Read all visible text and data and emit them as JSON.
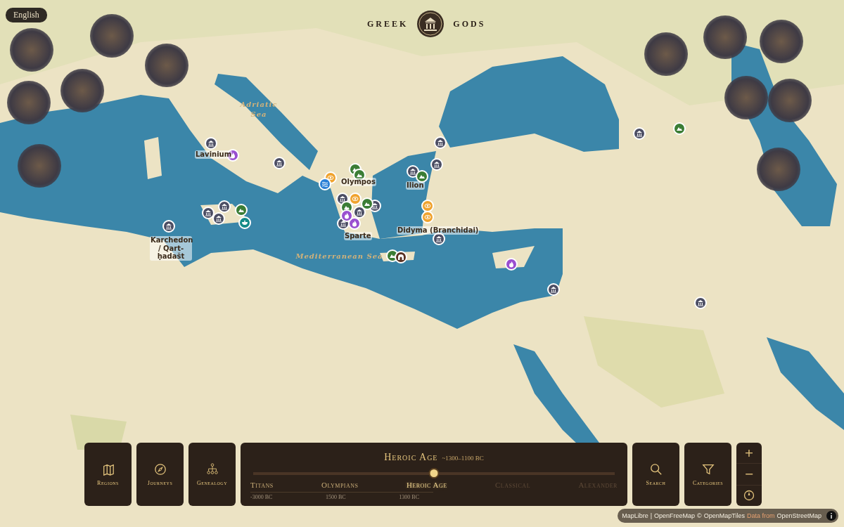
{
  "language": "English",
  "logo": {
    "left": "GREEK",
    "right": "GODS"
  },
  "sea_labels": [
    "Adriatic Sea",
    "Mediterranean Sea"
  ],
  "place_labels": [
    "Lavinium",
    "Olympos",
    "Ilion",
    "Sparte",
    "Didyma (Branchidai)",
    "Karchedon / Qart-ḥadašt"
  ],
  "markers": [
    {
      "kind": "temple",
      "color": "#4b4d63"
    },
    {
      "kind": "temple",
      "color": "#4b4d63"
    },
    {
      "kind": "temple",
      "color": "#4b4d63"
    },
    {
      "kind": "temple",
      "color": "#4b4d63"
    },
    {
      "kind": "temple",
      "color": "#4b4d63"
    },
    {
      "kind": "temple",
      "color": "#4b4d63"
    },
    {
      "kind": "temple",
      "color": "#4b4d63"
    },
    {
      "kind": "temple",
      "color": "#4b4d63"
    },
    {
      "kind": "temple",
      "color": "#4b4d63"
    },
    {
      "kind": "temple",
      "color": "#4b4d63"
    },
    {
      "kind": "temple",
      "color": "#4b4d63"
    },
    {
      "kind": "temple",
      "color": "#4b4d63"
    },
    {
      "kind": "temple",
      "color": "#4b4d63"
    },
    {
      "kind": "temple",
      "color": "#4b4d63"
    },
    {
      "kind": "temple",
      "color": "#4b4d63"
    },
    {
      "kind": "temple",
      "color": "#4b4d63"
    },
    {
      "kind": "temple",
      "color": "#4b4d63"
    },
    {
      "kind": "mountain",
      "color": "#3b7d35"
    },
    {
      "kind": "mountain",
      "color": "#3b7d35"
    },
    {
      "kind": "mountain",
      "color": "#3b7d35"
    },
    {
      "kind": "mountain",
      "color": "#3b7d35"
    },
    {
      "kind": "mountain",
      "color": "#3b7d35"
    },
    {
      "kind": "mountain",
      "color": "#3b7d35"
    },
    {
      "kind": "mountain",
      "color": "#3b7d35"
    },
    {
      "kind": "mountain",
      "color": "#3b7d35"
    },
    {
      "kind": "flame",
      "color": "#9a4fd0"
    },
    {
      "kind": "flame",
      "color": "#9a4fd0"
    },
    {
      "kind": "flame",
      "color": "#9a4fd0"
    },
    {
      "kind": "flame",
      "color": "#9a4fd0"
    },
    {
      "kind": "eye",
      "color": "#f0a32e"
    },
    {
      "kind": "eye",
      "color": "#f0a32e"
    },
    {
      "kind": "eye",
      "color": "#f0a32e"
    },
    {
      "kind": "eye",
      "color": "#f0a32e"
    },
    {
      "kind": "waves",
      "color": "#2a7fd6"
    },
    {
      "kind": "bowl",
      "color": "#148a88"
    },
    {
      "kind": "cave",
      "color": "#5a3222"
    }
  ],
  "nav_buttons": [
    {
      "kind": "map",
      "label": "Regions"
    },
    {
      "kind": "compass",
      "label": "Journeys"
    },
    {
      "kind": "tree",
      "label": "Genealogy"
    }
  ],
  "timeline": {
    "title": "Heroic Age",
    "range": "~1300–1100 BC",
    "level": 0.5,
    "eras": [
      {
        "label": "Titans",
        "selected": false,
        "reached": true
      },
      {
        "label": "Olympians",
        "selected": false,
        "reached": true
      },
      {
        "label": "Heroic Age",
        "selected": true,
        "reached": true
      },
      {
        "label": "Classical",
        "selected": false,
        "reached": false
      },
      {
        "label": "Alexander",
        "selected": false,
        "reached": false
      }
    ],
    "ticks": [
      "-3000 BC",
      "1500 BC",
      "1300 BC"
    ]
  },
  "tool_buttons": [
    {
      "kind": "search",
      "label": "Search"
    },
    {
      "kind": "filter",
      "label": "Categories"
    }
  ],
  "zoom": {
    "in": "+",
    "out": "−"
  },
  "attribution": {
    "parts": [
      {
        "kind": "link",
        "text": "MapLibre"
      },
      {
        "kind": "plain",
        "text": "|"
      },
      {
        "kind": "link",
        "text": "OpenFreeMap"
      },
      {
        "kind": "plain",
        "text": "©"
      },
      {
        "kind": "link",
        "text": "OpenMapTiles"
      },
      {
        "kind": "note",
        "text": "Data from"
      },
      {
        "kind": "link",
        "text": "OpenStreetMap"
      }
    ]
  }
}
